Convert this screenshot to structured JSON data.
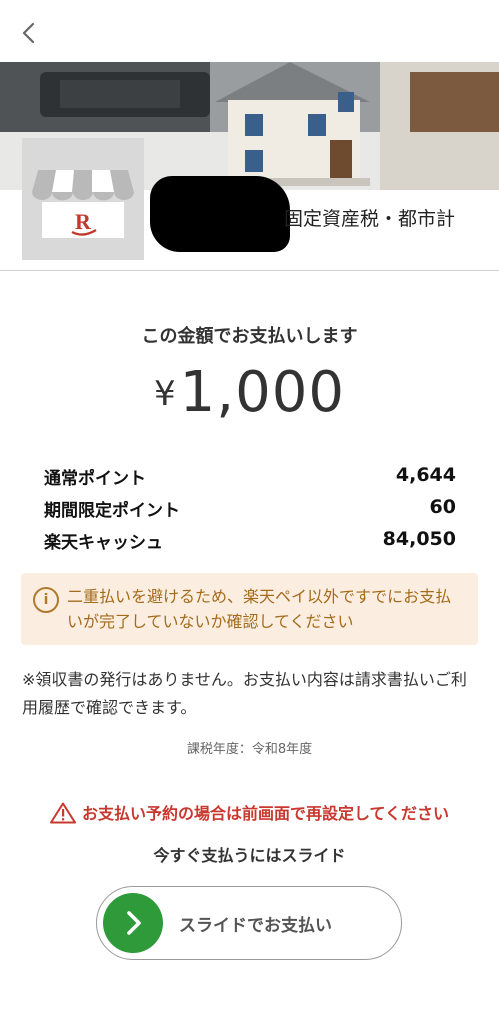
{
  "header": {
    "back_icon": "chevron-left-icon"
  },
  "merchant": {
    "name_visible": "固定資産税・都市計",
    "logo_letter": "R",
    "logo_color": "#c0392b"
  },
  "payment": {
    "heading": "この金額でお支払いします",
    "currency_symbol": "¥",
    "amount": "1,000",
    "points": [
      {
        "label": "通常ポイント",
        "value": "4,644"
      },
      {
        "label": "期間限定ポイント",
        "value": "60"
      },
      {
        "label": "楽天キャッシュ",
        "value": "84,050"
      }
    ]
  },
  "warning": {
    "icon": "info-icon",
    "text": "二重払いを避けるため、楽天ペイ以外ですでにお支払いが完了していないか確認してください"
  },
  "receipt_note": "※領収書の発行はありません。お支払い内容は請求書払いご利用履歴で確認できます。",
  "tax_year": "課税年度：令和8年度",
  "alert": {
    "icon": "warning-triangle-icon",
    "text": "お支払い予約の場合は前画面で再設定してください"
  },
  "slide": {
    "hint": "今すぐ支払うにはスライド",
    "button_label": "スライドでお支払い",
    "knob_icon": "chevron-right-icon",
    "accent": "#2f9a3a"
  }
}
